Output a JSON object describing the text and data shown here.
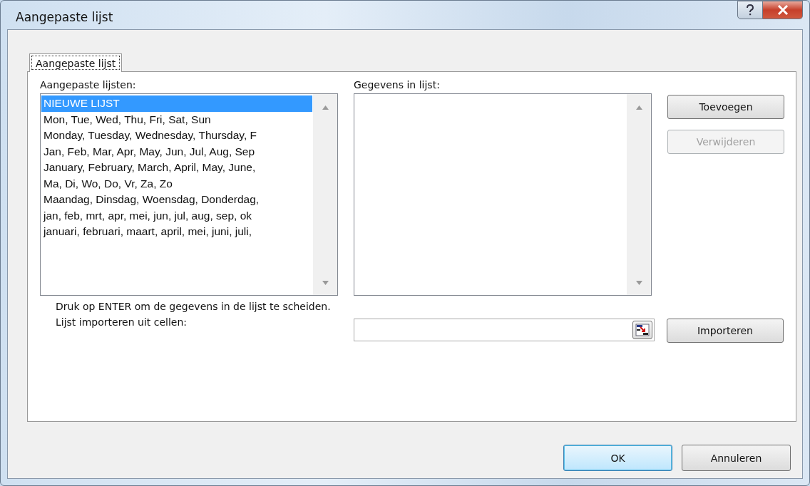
{
  "window": {
    "title": "Aangepaste lijst"
  },
  "tabs": [
    {
      "label": "Aangepaste lijst",
      "selected": true
    }
  ],
  "lists_label": "Aangepaste lijsten:",
  "lists": [
    {
      "text": "NIEUWE LIJST",
      "selected": true
    },
    {
      "text": "Mon, Tue, Wed, Thu, Fri, Sat, Sun",
      "selected": false
    },
    {
      "text": "Monday, Tuesday, Wednesday, Thursday, F",
      "selected": false
    },
    {
      "text": "Jan, Feb, Mar, Apr, May, Jun, Jul, Aug, Sep",
      "selected": false
    },
    {
      "text": "January, February, March, April, May, June,",
      "selected": false
    },
    {
      "text": "Ma, Di, Wo, Do, Vr, Za, Zo",
      "selected": false
    },
    {
      "text": "Maandag, Dinsdag, Woensdag, Donderdag,",
      "selected": false
    },
    {
      "text": "jan, feb, mrt, apr, mei, jun, jul, aug, sep, ok",
      "selected": false
    },
    {
      "text": "januari, februari, maart, april, mei, juni, juli,",
      "selected": false
    }
  ],
  "entries_label": "Gegevens in lijst:",
  "side_buttons": [
    {
      "label": "Toevoegen",
      "disabled": false
    },
    {
      "label": "Verwijderen",
      "disabled": true
    }
  ],
  "hint": "Druk op ENTER om de gegevens in de lijst te scheiden.",
  "import_label": "Lijst importeren uit cellen:",
  "import_button": {
    "label": "Importeren",
    "disabled": false
  },
  "footer_buttons": [
    {
      "label": "OK",
      "default": true
    },
    {
      "label": "Annuleren",
      "default": false
    }
  ]
}
